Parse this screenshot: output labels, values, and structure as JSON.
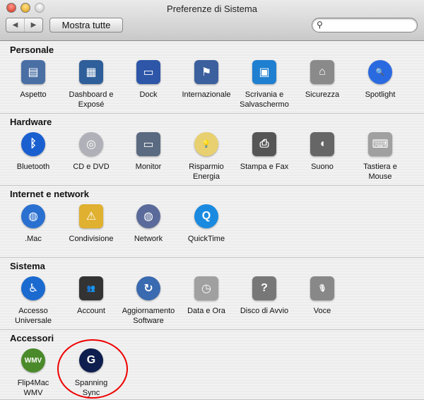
{
  "window": {
    "title": "Preferenze di Sistema"
  },
  "toolbar": {
    "back": "◀",
    "forward": "▶",
    "show_all": "Mostra tutte",
    "search_icon": "search-icon",
    "search_placeholder": "",
    "search_value": ""
  },
  "sections": [
    {
      "title": "Personale",
      "items": [
        {
          "label": "Aspetto",
          "icon": "appearance-icon",
          "glyph": "▤",
          "color": "#4a6fa5"
        },
        {
          "label": "Dashboard e\nExposé",
          "icon": "dashboard-expose-icon",
          "glyph": "▦",
          "color": "#2f5f9a"
        },
        {
          "label": "Dock",
          "icon": "dock-icon",
          "glyph": "▭",
          "color": "#2d56a8"
        },
        {
          "label": "Internazionale",
          "icon": "international-flag-icon",
          "glyph": "⚑",
          "color": "#3c5f9e"
        },
        {
          "label": "Scrivania e\nSalvaschermo",
          "icon": "desktop-screensaver-icon",
          "glyph": "▣",
          "color": "#1f7fd0"
        },
        {
          "label": "Sicurezza",
          "icon": "security-house-icon",
          "glyph": "⌂",
          "color": "#8a8a8a"
        },
        {
          "label": "Spotlight",
          "icon": "spotlight-icon",
          "glyph": "🔍",
          "color": "#2a6ae0",
          "round": true
        }
      ]
    },
    {
      "title": "Hardware",
      "items": [
        {
          "label": "Bluetooth",
          "icon": "bluetooth-icon",
          "glyph": "ᛒ",
          "color": "#1a5fd0",
          "round": true
        },
        {
          "label": "CD e DVD",
          "icon": "cd-dvd-icon",
          "glyph": "◎",
          "color": "#b0b0b8",
          "round": true
        },
        {
          "label": "Monitor",
          "icon": "monitor-icon",
          "glyph": "▭",
          "color": "#5a6a80"
        },
        {
          "label": "Risparmio\nEnergia",
          "icon": "energy-saver-bulb-icon",
          "glyph": "💡",
          "color": "#e8d070",
          "round": true
        },
        {
          "label": "Stampa e Fax",
          "icon": "printer-icon",
          "glyph": "⎙",
          "color": "#555"
        },
        {
          "label": "Suono",
          "icon": "speaker-icon",
          "glyph": "◖",
          "color": "#666"
        },
        {
          "label": "Tastiera e\nMouse",
          "icon": "keyboard-mouse-icon",
          "glyph": "⌨",
          "color": "#a0a0a0"
        }
      ]
    },
    {
      "title": "Internet e network",
      "items": [
        {
          "label": ".Mac",
          "icon": "dotmac-globe-icon",
          "glyph": "◍",
          "color": "#2a70d0",
          "round": true
        },
        {
          "label": "Condivisione",
          "icon": "sharing-folder-icon",
          "glyph": "⚠",
          "color": "#e0b030"
        },
        {
          "label": "Network",
          "icon": "network-globe-icon",
          "glyph": "◍",
          "color": "#5a6a9a",
          "round": true
        },
        {
          "label": "QuickTime",
          "icon": "quicktime-icon",
          "glyph": "Q",
          "color": "#1a8ae0",
          "round": true
        }
      ]
    },
    {
      "title": "Sistema",
      "items": [
        {
          "label": "Accesso\nUniversale",
          "icon": "universal-access-icon",
          "glyph": "♿",
          "color": "#1a6ad0",
          "round": true
        },
        {
          "label": "Account",
          "icon": "accounts-users-icon",
          "glyph": "👥",
          "color": "#333"
        },
        {
          "label": "Aggiornamento\nSoftware",
          "icon": "software-update-icon",
          "glyph": "↻",
          "color": "#3a6ab0",
          "round": true
        },
        {
          "label": "Data e Ora",
          "icon": "date-time-clock-icon",
          "glyph": "◷",
          "color": "#a0a0a0"
        },
        {
          "label": "Disco di Avvio",
          "icon": "startup-disk-icon",
          "glyph": "?",
          "color": "#777"
        },
        {
          "label": "Voce",
          "icon": "speech-microphone-icon",
          "glyph": "🎙",
          "color": "#888"
        }
      ]
    },
    {
      "title": "Accessori",
      "items": [
        {
          "label": "Flip4Mac\nWMV",
          "icon": "flip4mac-wmv-icon",
          "glyph": "WMV",
          "color": "#4a8a2a",
          "round": true
        },
        {
          "label": "Spanning\nSync",
          "icon": "spanning-sync-icon",
          "glyph": "G",
          "color": "#0e1e4e",
          "round": true
        }
      ]
    }
  ]
}
